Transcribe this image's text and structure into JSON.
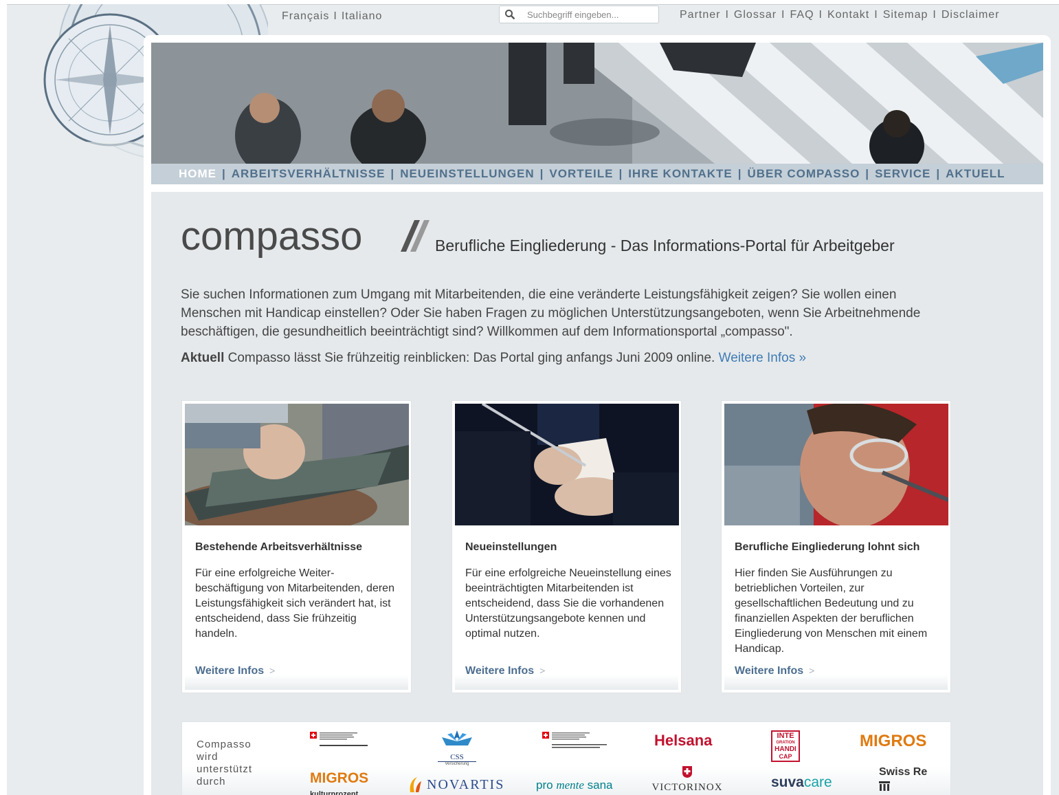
{
  "top": {
    "languages": [
      "Français",
      "Italiano"
    ],
    "search_placeholder": "Suchbegriff eingeben...",
    "links": [
      "Partner",
      "Glossar",
      "FAQ",
      "Kontakt",
      "Sitemap",
      "Disclaimer"
    ]
  },
  "nav": {
    "items": [
      "HOME",
      "ARBEITSVERHÄLTNISSE",
      "NEUEINSTELLUNGEN",
      "VORTEILE",
      "IHRE KONTAKTE",
      "ÜBER COMPASSO",
      "SERVICE",
      "AKTUELL"
    ],
    "active": "HOME"
  },
  "header": {
    "logo": "compasso",
    "tagline": "Berufliche Eingliederung - Das Informations-Portal für Arbeitgeber"
  },
  "intro": "Sie suchen Informationen zum Umgang mit Mitarbeitenden, die eine veränderte Leistungsfähigkeit zeigen? Sie wollen einen Menschen mit Handicap einstellen? Oder Sie haben Fragen zu möglichen Unterstützungsangeboten, wenn Sie Arbeitnehmende beschäftigen, die gesundheitlich beeinträchtigt sind? Willkommen auf dem Informationsportal „compasso\".",
  "news": {
    "label": "Aktuell",
    "text": " Compasso lässt Sie frühzeitig reinblicken: Das Portal ging anfangs Juni 2009 online. ",
    "link": "Weitere Infos »"
  },
  "cards": [
    {
      "title": "Bestehende Arbeitsverhältnisse",
      "text": "Für eine erfolgreiche Weiter-beschäftigung von Mitarbeitenden, deren Leistungsfähigkeit sich verändert hat, ist entscheidend, dass Sie frühzeitig handeln.",
      "more": "Weitere Infos"
    },
    {
      "title": "Neueinstellungen",
      "text": "Für eine erfolgreiche Neueinstellung eines beeinträchtigten Mitarbeitenden ist entscheidend, dass Sie die vorhandenen Unterstützungsangebote kennen und optimal nutzen.",
      "more": "Weitere Infos"
    },
    {
      "title": "Berufliche Eingliederung lohnt sich",
      "text": "Hier finden Sie Ausführungen zu betrieblichen Vorteilen, zur gesellschaftlichen Bedeutung und zu finanziellen Aspekten der beruflichen Eingliederung von Menschen mit einem Handicap.",
      "more": "Weitere Infos"
    }
  ],
  "sponsors": {
    "label": "Compasso wird unterstützt durch",
    "logos": {
      "css": "CSS",
      "css_sub": "Versicherung",
      "helsana": "Helsana",
      "migros": "MIGROS",
      "migros_kp": "MIGROS",
      "migros_kp_sub": "kulturprozent",
      "novartis": "NOVARTIS",
      "promente_a": "pro",
      "promente_b": "mente",
      "promente_c": "sana",
      "victorinox": "VICTORINOX",
      "suva_a": "suva",
      "suva_b": "care",
      "swissre": "Swiss Re",
      "integration_1": "INTE",
      "integration_2": "GRATION",
      "integration_3": "HANDI",
      "integration_4": "CAP"
    }
  },
  "colors": {
    "nav_text": "#51708b",
    "link": "#3f7bb5",
    "card_more": "#4c6e8f",
    "page_bg": "#e5e9eb"
  }
}
